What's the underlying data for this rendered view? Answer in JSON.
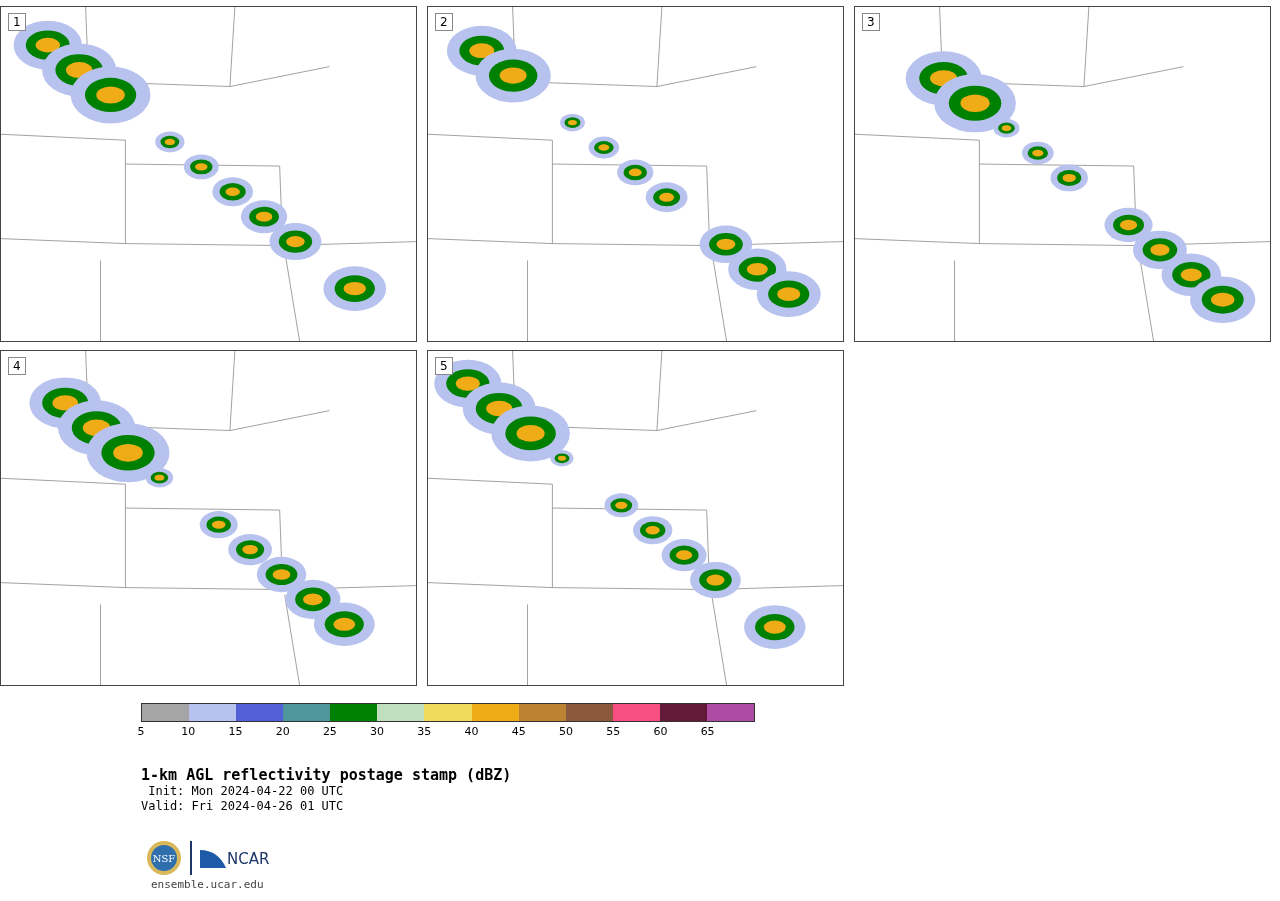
{
  "panels": [
    {
      "label": "1"
    },
    {
      "label": "2"
    },
    {
      "label": "3"
    },
    {
      "label": "4"
    },
    {
      "label": "5"
    }
  ],
  "colorbar": {
    "bins": [
      {
        "color": "#a5a5a5"
      },
      {
        "color": "#b7c2ee"
      },
      {
        "color": "#5160d6"
      },
      {
        "color": "#4f969c"
      },
      {
        "color": "#008000"
      },
      {
        "color": "#bfdfbf"
      },
      {
        "color": "#f0da5e"
      },
      {
        "color": "#f0ac17"
      },
      {
        "color": "#bb8232"
      },
      {
        "color": "#8b5a3e"
      },
      {
        "color": "#f75080"
      },
      {
        "color": "#621a38"
      },
      {
        "color": "#ae4ba2"
      }
    ],
    "ticks": [
      "5",
      "10",
      "15",
      "20",
      "25",
      "30",
      "35",
      "40",
      "45",
      "50",
      "55",
      "60",
      "65"
    ]
  },
  "title": "1-km AGL reflectivity postage stamp (dBZ)",
  "init": " Init: Mon 2024-04-22 00 UTC",
  "valid": "Valid: Fri 2024-04-26 01 UTC",
  "logos": {
    "left": "NSF",
    "right": "NCAR"
  },
  "footer": "ensemble.ucar.edu"
}
